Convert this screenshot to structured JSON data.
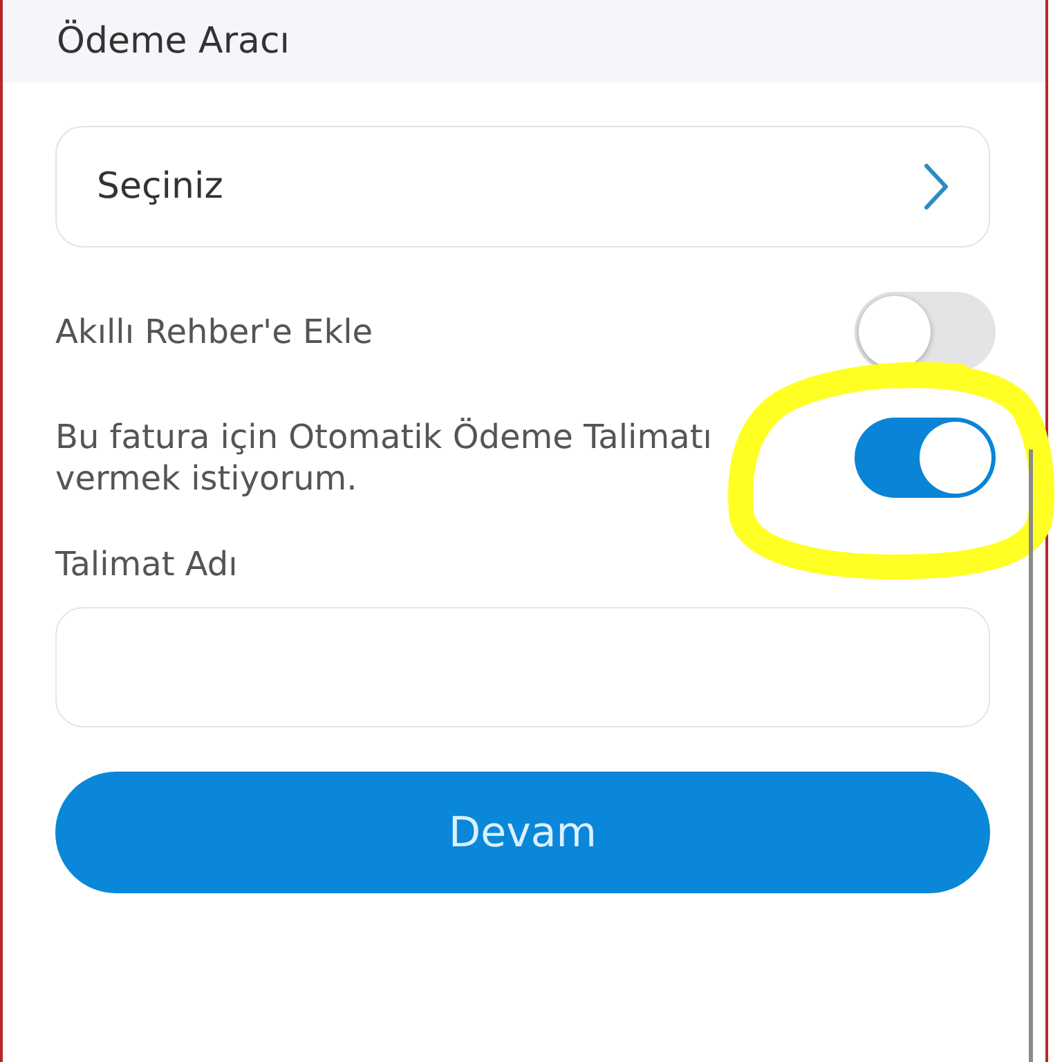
{
  "header": {
    "title": "Ödeme Aracı"
  },
  "payment_method": {
    "value": "Seçiniz"
  },
  "toggles": [
    {
      "label": "Akıllı Rehber'e Ekle",
      "on": false,
      "highlighted": false
    },
    {
      "label": "Bu fatura için Otomatik Ödeme Talimatı vermek istiyorum.",
      "on": true,
      "highlighted": true
    }
  ],
  "fields": [
    {
      "label": "Talimat Adı"
    }
  ],
  "button": {
    "label": "Devam"
  }
}
